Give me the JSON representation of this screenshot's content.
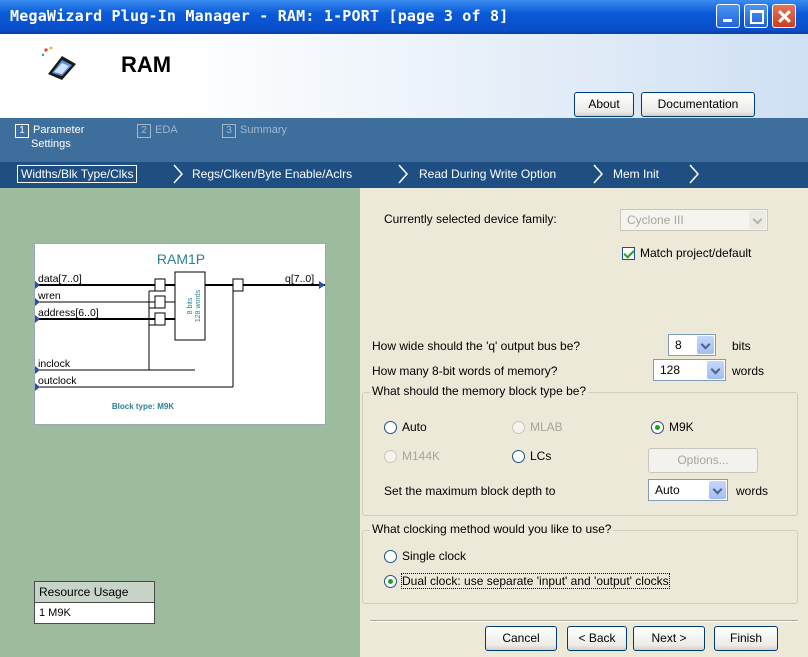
{
  "window": {
    "title": "MegaWizard Plug-In Manager - RAM: 1-PORT [page 3 of 8]"
  },
  "header": {
    "heading": "RAM",
    "about_label": "About",
    "documentation_label": "Documentation"
  },
  "page_tabs": [
    {
      "num": "1",
      "label": "Parameter",
      "sublabel": "Settings"
    },
    {
      "num": "2",
      "label": "EDA"
    },
    {
      "num": "3",
      "label": "Summary"
    }
  ],
  "breadcrumbs": [
    "Widths/Blk Type/Clks",
    "Regs/Clken/Byte Enable/Aclrs",
    "Read During Write Option",
    "Mem Init"
  ],
  "diagram": {
    "title": "RAM1P",
    "ports_in": [
      "data[7..0]",
      "wren",
      "address[6..0]",
      "inclock",
      "outclock"
    ],
    "port_out": "q[7..0]",
    "block_caption": "8 bits\n128 words",
    "block_type": "Block type: M9K"
  },
  "resource": {
    "header": "Resource Usage",
    "value": "1 M9K"
  },
  "settings": {
    "device_family_label": "Currently selected device family:",
    "device_family_value": "Cyclone III",
    "match_label": "Match project/default",
    "match_checked": true,
    "q_width_label": "How wide should the 'q' output bus be?",
    "q_width_value": "8",
    "q_width_unit": "bits",
    "words_label": "How many 8-bit words of memory?",
    "words_value": "128",
    "words_unit": "words",
    "block_type_legend": "What should the memory block type be?",
    "block_type_options": [
      "Auto",
      "MLAB",
      "M9K",
      "M144K",
      "LCs"
    ],
    "block_type_selected": "M9K",
    "options_label": "Options...",
    "max_depth_label": "Set the maximum block depth to",
    "max_depth_value": "Auto",
    "max_depth_unit": "words",
    "clocking_legend": "What clocking method would you like to use?",
    "clock_single": "Single clock",
    "clock_dual": "Dual clock: use separate 'input' and 'output' clocks",
    "clock_selected": "dual"
  },
  "footer": {
    "cancel": "Cancel",
    "back": "< Back",
    "next": "Next >",
    "finish": "Finish"
  }
}
